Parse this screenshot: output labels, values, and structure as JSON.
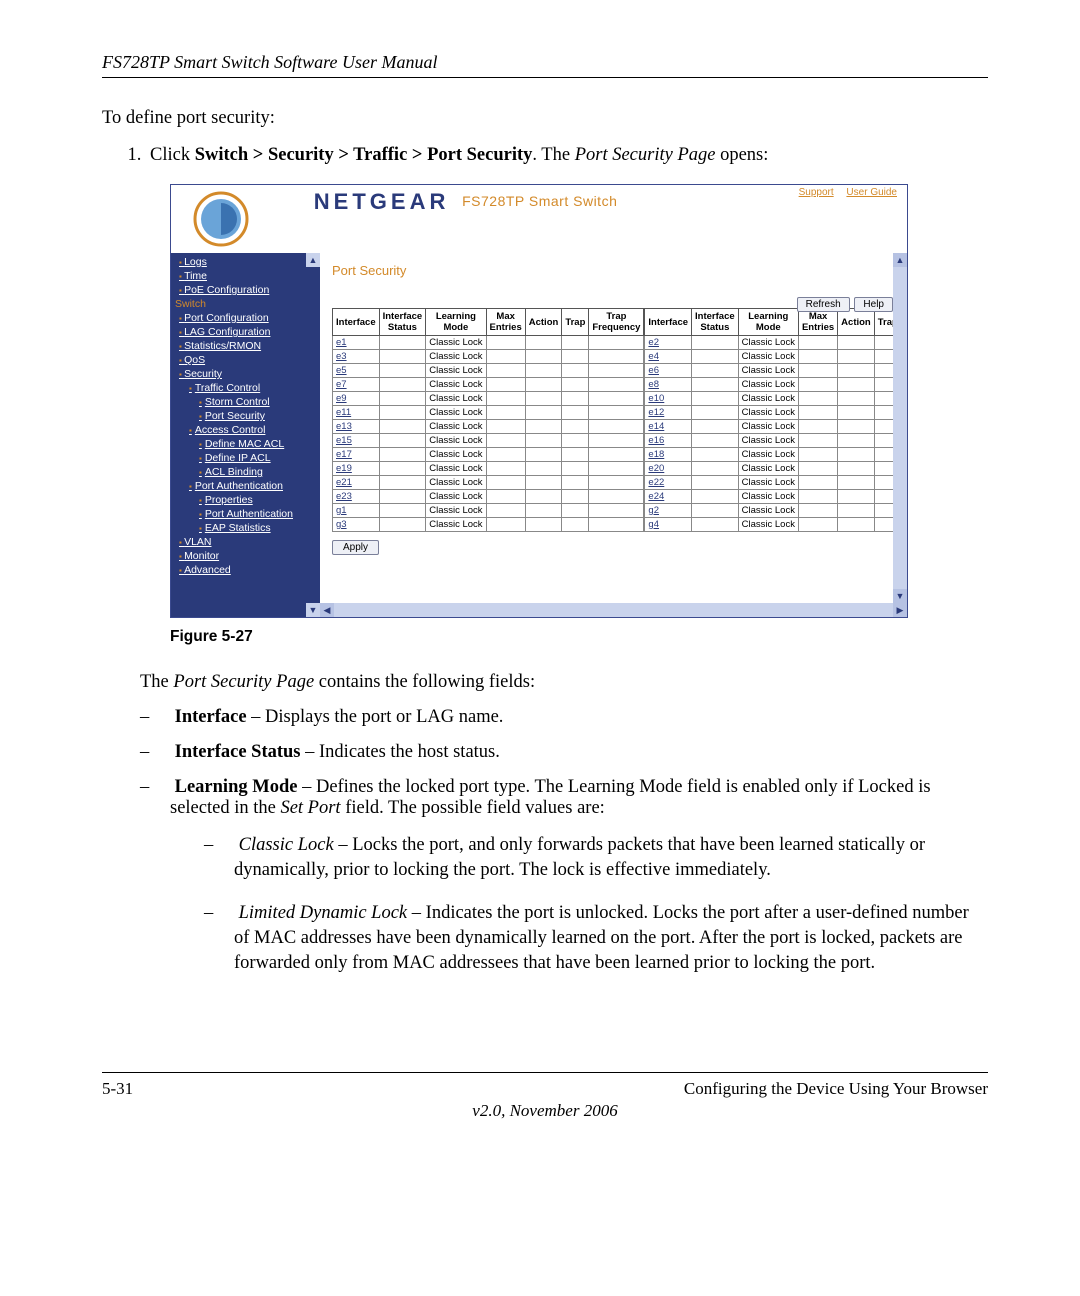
{
  "doc": {
    "header": "FS728TP Smart Switch Software User Manual",
    "intro": "To define port security:",
    "step1_pre": "Click ",
    "step1_bold": "Switch > Security > Traffic > Port Security",
    "step1_mid": ". The ",
    "step1_italic": "Port Security Page",
    "step1_post": " opens:",
    "figlabel": "Figure 5-27",
    "after": "The Port Security Page contains the following fields:",
    "after_italic_span": "Port Security Page",
    "field_interface_b": "Interface",
    "field_interface_t": " – Displays the port or LAG name.",
    "field_status_b": "Interface Status",
    "field_status_t": " – Indicates the host status.",
    "field_learn_b": "Learning Mode",
    "field_learn_t": " – Defines the locked port type. The Learning Mode field is enabled only if Locked is selected in the ",
    "field_learn_i": "Set Port",
    "field_learn_t2": " field. The possible field values are:",
    "sub_classic_i": "Classic Lock",
    "sub_classic_t": " – Locks the port, and only forwards packets that have been learned statically or dynamically, prior to locking the port. The lock is effective immediately.",
    "sub_limited_i": "Limited Dynamic Lock",
    "sub_limited_t": " – Indicates the port is unlocked. Locks the port after a user-defined number of MAC addresses have been dynamically learned on the port. After the port is locked, packets are forwarded only from MAC addressees that have been learned prior to locking the port.",
    "page_left": "5-31",
    "page_right": "Configuring the Device Using Your Browser",
    "version": "v2.0, November 2006"
  },
  "app": {
    "brand": "NETGEAR",
    "brand_sub": "FS728TP Smart Switch",
    "top_support": "Support",
    "top_guide": "User Guide",
    "sidebar": {
      "logs": "Logs",
      "time": "Time",
      "poe": "PoE Configuration",
      "switch_section": "Switch",
      "port_cfg": "Port Configuration",
      "lag_cfg": "LAG Configuration",
      "stats": "Statistics/RMON",
      "qos": "QoS",
      "security": "Security",
      "traffic_ctrl": "Traffic Control",
      "storm": "Storm Control",
      "port_sec": "Port Security",
      "access_ctrl": "Access Control",
      "def_mac": "Define MAC ACL",
      "def_ip": "Define IP ACL",
      "acl_bind": "ACL Binding",
      "port_auth": "Port Authentication",
      "properties": "Properties",
      "port_auth2": "Port Authentication",
      "eap": "EAP Statistics",
      "vlan": "VLAN",
      "monitor": "Monitor",
      "advanced": "Advanced"
    },
    "main": {
      "title": "Port Security",
      "refresh": "Refresh",
      "help": "Help",
      "apply": "Apply",
      "headers": {
        "interface": "Interface",
        "interface_status": "Interface Status",
        "learning_mode": "Learning Mode",
        "max_entries": "Max Entries",
        "action": "Action",
        "trap": "Trap",
        "trap_freq": "Trap Frequency"
      },
      "rows_left": [
        {
          "if": "e1",
          "mode": "Classic Lock"
        },
        {
          "if": "e3",
          "mode": "Classic Lock"
        },
        {
          "if": "e5",
          "mode": "Classic Lock"
        },
        {
          "if": "e7",
          "mode": "Classic Lock"
        },
        {
          "if": "e9",
          "mode": "Classic Lock"
        },
        {
          "if": "e11",
          "mode": "Classic Lock"
        },
        {
          "if": "e13",
          "mode": "Classic Lock"
        },
        {
          "if": "e15",
          "mode": "Classic Lock"
        },
        {
          "if": "e17",
          "mode": "Classic Lock"
        },
        {
          "if": "e19",
          "mode": "Classic Lock"
        },
        {
          "if": "e21",
          "mode": "Classic Lock"
        },
        {
          "if": "e23",
          "mode": "Classic Lock"
        },
        {
          "if": "g1",
          "mode": "Classic Lock"
        },
        {
          "if": "g3",
          "mode": "Classic Lock"
        }
      ],
      "rows_right": [
        {
          "if": "e2",
          "mode": "Classic Lock"
        },
        {
          "if": "e4",
          "mode": "Classic Lock"
        },
        {
          "if": "e6",
          "mode": "Classic Lock"
        },
        {
          "if": "e8",
          "mode": "Classic Lock"
        },
        {
          "if": "e10",
          "mode": "Classic Lock"
        },
        {
          "if": "e12",
          "mode": "Classic Lock"
        },
        {
          "if": "e14",
          "mode": "Classic Lock"
        },
        {
          "if": "e16",
          "mode": "Classic Lock"
        },
        {
          "if": "e18",
          "mode": "Classic Lock"
        },
        {
          "if": "e20",
          "mode": "Classic Lock"
        },
        {
          "if": "e22",
          "mode": "Classic Lock"
        },
        {
          "if": "e24",
          "mode": "Classic Lock"
        },
        {
          "if": "g2",
          "mode": "Classic Lock"
        },
        {
          "if": "g4",
          "mode": "Classic Lock"
        }
      ]
    }
  }
}
